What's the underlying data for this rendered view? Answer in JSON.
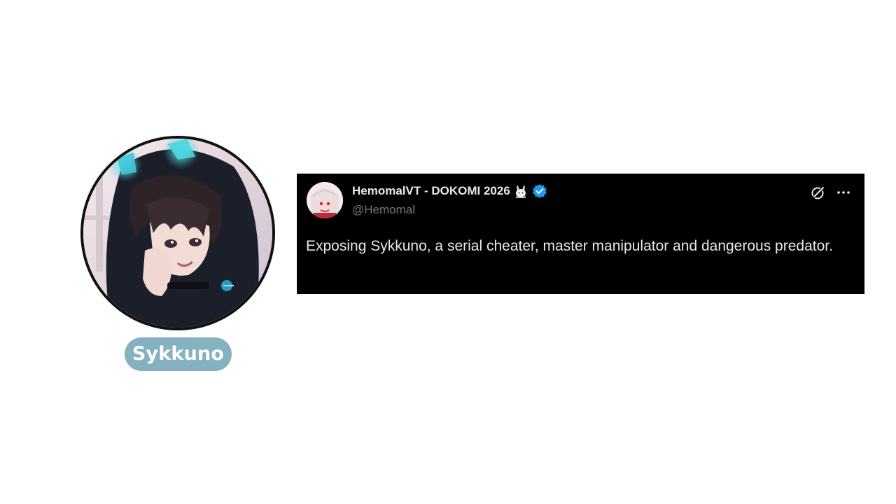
{
  "profile": {
    "name": "Sykkuno",
    "avatar_icon": "anime-avatar-portrait",
    "pill_color": "#86b1c1"
  },
  "tweet": {
    "display_name": "HemomalVT - DOKOMI 2026",
    "name_emoji": "bunny-emoji",
    "verified": true,
    "verified_color": "#1d9bf0",
    "handle": "@Hemomal",
    "text": "Exposing Sykkuno, a serial cheater, master manipulator and dangerous predator.",
    "actions": {
      "grok_icon": "grok-icon",
      "more_icon": "more-options-icon"
    },
    "background": "#000000",
    "text_color": "#e7e9ea",
    "handle_color": "#71767b"
  }
}
